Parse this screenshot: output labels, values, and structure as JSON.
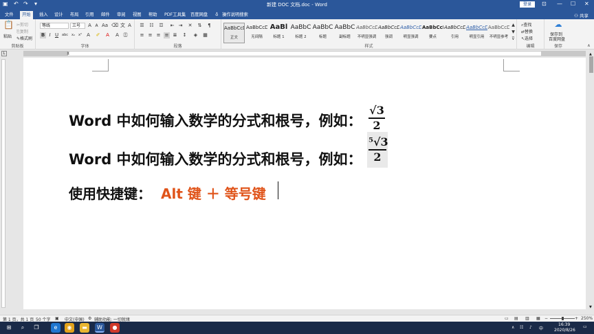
{
  "window": {
    "title": "新建 DOC 文档.doc  -  Word",
    "login": "登录"
  },
  "tabs": [
    "文件",
    "开始",
    "插入",
    "设计",
    "布局",
    "引用",
    "邮件",
    "审阅",
    "视图",
    "帮助",
    "PDF工具集",
    "百度网盘",
    "操作说明搜索"
  ],
  "active_tab": "开始",
  "share": "共享",
  "ribbon": {
    "clipboard": {
      "label": "剪贴板",
      "paste": "粘贴",
      "cut": "剪切",
      "copy": "复制",
      "format_painter": "格式刷"
    },
    "font": {
      "label": "字体",
      "font_name": "等线",
      "font_size": "三号"
    },
    "paragraph": {
      "label": "段落"
    },
    "styles": {
      "label": "样式",
      "items": [
        {
          "preview": "AaBbCcD",
          "name": "正文"
        },
        {
          "preview": "AaBbCcD",
          "name": "无间隔"
        },
        {
          "preview": "AaBl",
          "name": "标题 1"
        },
        {
          "preview": "AaBbC",
          "name": "标题 2"
        },
        {
          "preview": "AaBbC",
          "name": "标题"
        },
        {
          "preview": "AaBbC",
          "name": "副标题"
        },
        {
          "preview": "AaBbCcD",
          "name": "不明显强调"
        },
        {
          "preview": "AaBbCcD",
          "name": "强调"
        },
        {
          "preview": "AaBbCcD",
          "name": "明显强调"
        },
        {
          "preview": "AaBbCcD",
          "name": "要点"
        },
        {
          "preview": "AaBbCcD",
          "name": "引用"
        },
        {
          "preview": "AaBbCcD",
          "name": "明显引用"
        },
        {
          "preview": "AaBbCcDi",
          "name": "不明显参考"
        }
      ]
    },
    "editing": {
      "label": "编辑",
      "find": "查找",
      "replace": "替换",
      "select": "选择"
    },
    "save": {
      "label": "保存",
      "save_to": "保存到",
      "netdisk": "百度网盘"
    }
  },
  "document": {
    "line1": "Word 中如何输入数学的分式和根号，例如：",
    "frac1": {
      "num": "√3",
      "den": "2"
    },
    "line2": "Word 中如何输入数学的分式和根号，例如：",
    "frac2": {
      "num": "⁵√3",
      "den": "2"
    },
    "line3_prefix": "使用快捷键：",
    "line3_shortcut": "Alt 键 ＋ 等号键",
    "highlight_color": "#e0541a"
  },
  "status": {
    "page": "第 1 页，共 1 页",
    "words": "50 个字",
    "lang": "中文(中国)",
    "access": "辅助功能: 一切就绪",
    "zoom": "250%"
  },
  "taskbar": {
    "time": "16:39",
    "date": "2020/8/26",
    "ime": "中"
  }
}
